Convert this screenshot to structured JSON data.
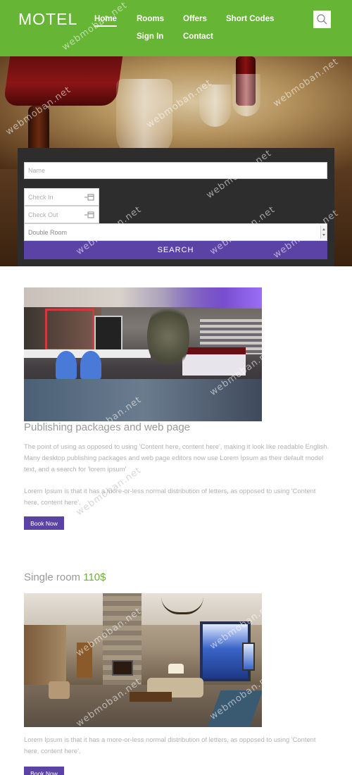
{
  "header": {
    "logo": "MOTEL",
    "nav": [
      {
        "label": "Home",
        "active": true
      },
      {
        "label": "Rooms",
        "active": false
      },
      {
        "label": "Offers",
        "active": false
      },
      {
        "label": "Short Codes",
        "active": false
      },
      {
        "label": "Sign In",
        "active": false
      },
      {
        "label": "Contact",
        "active": false
      }
    ],
    "search_icon": "search-icon",
    "color": "#66b535"
  },
  "booking": {
    "name_placeholder": "Name",
    "checkin_placeholder": "Check In",
    "checkout_placeholder": "Check Out",
    "room_type": "Double Room",
    "search_label": "SEARCH",
    "button_color": "#5b43a5"
  },
  "content": {
    "section1": {
      "title": "Publishing packages and web page",
      "paragraph1": "The point of using as opposed to using 'Content here, content here', making it look like readable English. Many desktop publishing packages and web page editors now use Lorem Ipsum as their default model text, and a search for 'lorem ipsum'",
      "paragraph2": "Lorem Ipsum is that it has a more-or-less normal distribution of letters, as opposed to using 'Content here, content here',",
      "button": "Book Now"
    },
    "section2": {
      "title": "Single room",
      "price": "110$",
      "paragraph": "Lorem Ipsum is that it has a more-or-less normal distribution of letters, as opposed to using 'Content here, content here',",
      "button": "Book Now"
    }
  },
  "watermark": "webmoban.net"
}
